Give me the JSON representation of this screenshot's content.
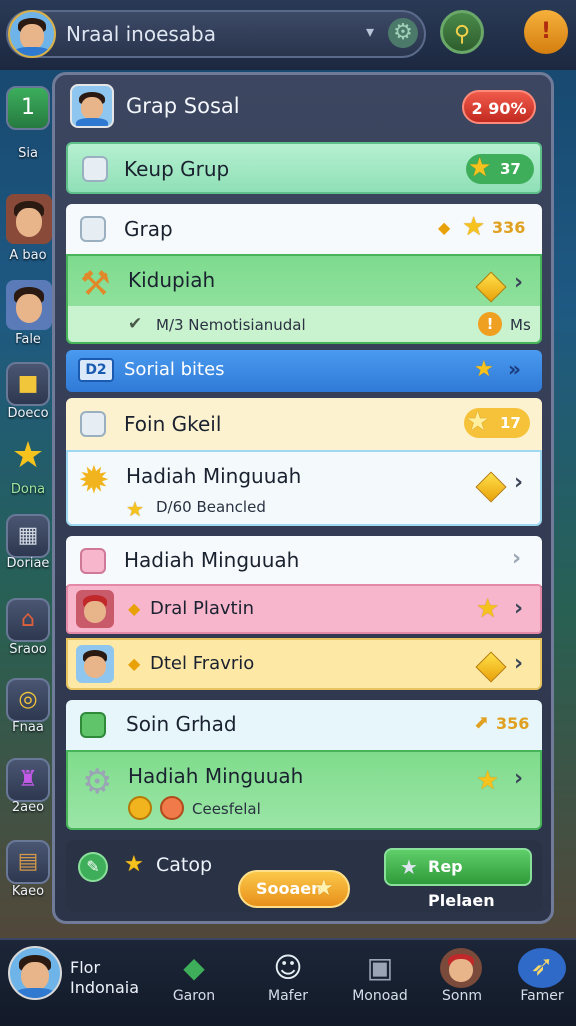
{
  "top_bar": {
    "player_name": "Nraal inoesaba",
    "dropdown_glyph": "▾",
    "settings_icon": "gear-icon",
    "mid_button_icon": "joystick-icon",
    "alert_button_label": "!"
  },
  "side_menu": [
    {
      "label": "Sia",
      "icon": "lock-icon",
      "glyph": "1"
    },
    {
      "label": "A bao",
      "icon": "friend-avatar"
    },
    {
      "label": "Fale",
      "icon": "friend-avatar"
    },
    {
      "label": "Doeco",
      "icon": "cube-icon",
      "glyph": "■"
    },
    {
      "label": "Dona",
      "icon": "star-icon",
      "glyph": "★"
    },
    {
      "label": "Doriae",
      "icon": "box-icon",
      "glyph": "▦"
    },
    {
      "label": "Sraoo",
      "icon": "house-icon",
      "glyph": "⌂"
    },
    {
      "label": "Fnaa",
      "icon": "coin-icon",
      "glyph": "◎"
    },
    {
      "label": "2aeo",
      "icon": "potion-icon",
      "glyph": "♜"
    },
    {
      "label": "Kaeo",
      "icon": "chest-icon",
      "glyph": "▤"
    }
  ],
  "panel": {
    "title": "Grap Sosal",
    "badge": "2 90%",
    "rows": {
      "keep_group": {
        "label": "Keup Grup",
        "count": "37"
      },
      "grap": {
        "label": "Grap",
        "count": "336"
      },
      "kidupiah": {
        "label": "Kidupiah",
        "sub": "M/3 Nemotisianudal",
        "sub_right": "Ms",
        "badge_glyph": "!"
      },
      "social": {
        "label": "Sorial bites",
        "tag": "D2"
      },
      "foin": {
        "label": "Foin Gkeil",
        "count": "17"
      },
      "hadiah1": {
        "label": "Hadiah Minguuah",
        "sub": "D/60 Beancled"
      },
      "hadiah2": {
        "label": "Hadiah Minguuah"
      },
      "dral": {
        "label": "Dral Plavtin"
      },
      "drel": {
        "label": "Dtel Fravrio"
      },
      "soin": {
        "label": "Soin Grhad",
        "count": "356"
      },
      "hadiah3": {
        "label": "Hadiah Minguuah",
        "sub": "Ceesfelal"
      }
    },
    "footer": {
      "left_label": "Catop",
      "center_button": "Sooaen",
      "right_button": "Rep Plelaen"
    }
  },
  "bottom_nav": {
    "profile_line1": "Flor",
    "profile_line2": "Indonaia",
    "items": [
      {
        "label": "Garon",
        "icon": "compass-icon",
        "glyph": "◆"
      },
      {
        "label": "Mafer",
        "icon": "smile-icon",
        "glyph": "☺"
      },
      {
        "label": "Monoad",
        "icon": "gift-icon",
        "glyph": "▣"
      },
      {
        "label": "Sonm",
        "icon": "character-icon"
      },
      {
        "label": "Famer",
        "icon": "rocket-icon",
        "glyph": "➶"
      }
    ]
  },
  "colors": {
    "mint": "#9ee6bd",
    "green": "#7fdc8c",
    "blue": "#3f8ee8",
    "cream": "#fdf2cf",
    "pink": "#f7b6cc",
    "yellow": "#fde8a6",
    "white": "#f6f8fb"
  }
}
